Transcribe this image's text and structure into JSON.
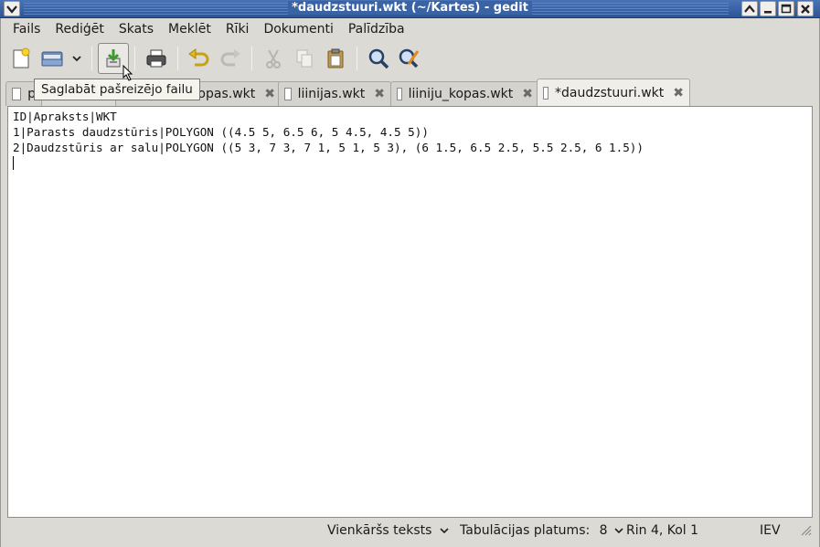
{
  "window": {
    "title": "*daudzstuuri.wkt (~/Kartes) - gedit"
  },
  "menu": [
    "Fails",
    "Rediģēt",
    "Skats",
    "Meklēt",
    "Rīki",
    "Dokumenti",
    "Palīdzība"
  ],
  "toolbar": {
    "buttons": [
      "new-document",
      "open",
      "open-recent",
      "save",
      "print",
      "undo",
      "redo",
      "cut",
      "copy",
      "paste",
      "find",
      "replace"
    ],
    "tooltip": "Saglabāt pašreizējo failu"
  },
  "tabs": [
    {
      "label": "p",
      "active": false
    },
    {
      "label": "kopas.wkt",
      "active": false
    },
    {
      "label": "liinijas.wkt",
      "active": false
    },
    {
      "label": "liiniju_kopas.wkt",
      "active": false
    },
    {
      "label": "*daudzstuuri.wkt",
      "active": true
    }
  ],
  "editor": {
    "lines": [
      "ID|Apraksts|WKT",
      "1|Parasts daudzstūris|POLYGON ((4.5 5, 6.5 6, 5 4.5, 4.5 5))",
      "2|Daudzstūris ar salu|POLYGON ((5 3, 7 3, 7 1, 5 1, 5 3), (6 1.5, 6.5 2.5, 5.5 2.5, 6 1.5))",
      ""
    ]
  },
  "statusbar": {
    "language": "Vienkāršs teksts",
    "tab_width_label": "Tabulācijas platums:",
    "tab_width_value": "8",
    "position": "Rin 4, Kol 1",
    "mode": "IEV"
  },
  "colors": {
    "titlebar": "#3a63a6",
    "background": "#dcdad5",
    "tooltip": "#f5f4ed"
  }
}
